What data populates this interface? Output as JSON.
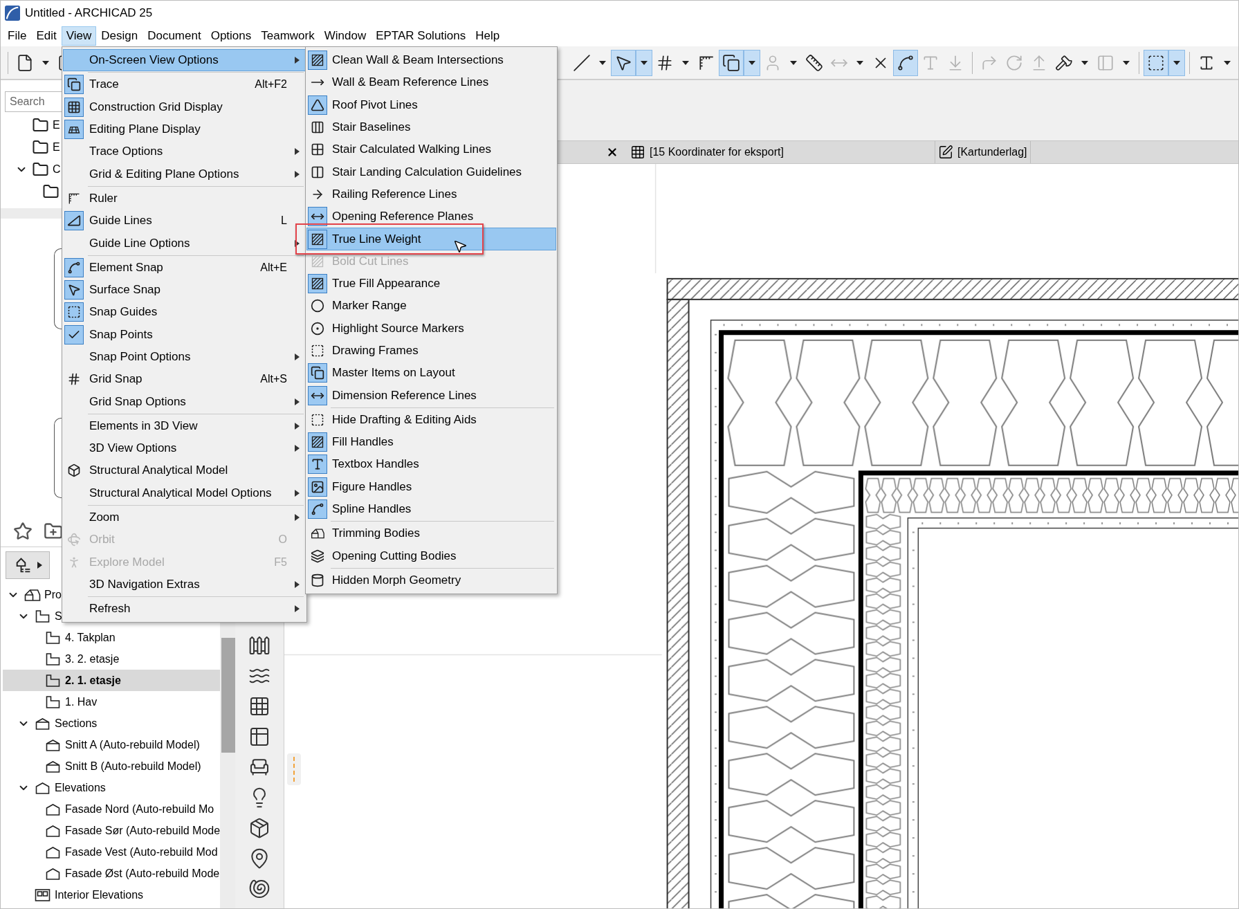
{
  "window": {
    "title": "Untitled - ARCHICAD 25"
  },
  "menu_bar": [
    {
      "label": "File",
      "selected": false
    },
    {
      "label": "Edit",
      "selected": false
    },
    {
      "label": "View",
      "selected": true
    },
    {
      "label": "Design",
      "selected": false
    },
    {
      "label": "Document",
      "selected": false
    },
    {
      "label": "Options",
      "selected": false
    },
    {
      "label": "Teamwork",
      "selected": false
    },
    {
      "label": "Window",
      "selected": false
    },
    {
      "label": "EPTAR Solutions",
      "selected": false
    },
    {
      "label": "Help",
      "selected": false
    }
  ],
  "toolbar": [
    {
      "kind": "separator"
    },
    {
      "kind": "button",
      "selected": false,
      "disabled": false
    },
    {
      "kind": "caret",
      "selected": false
    },
    {
      "kind": "button",
      "selected": false,
      "disabled": false
    },
    {
      "kind": "spacer"
    },
    {
      "kind": "button",
      "selected": false,
      "disabled": false
    },
    {
      "kind": "caret",
      "selected": false
    },
    {
      "kind": "button",
      "selected": true,
      "disabled": false
    },
    {
      "kind": "caret",
      "selected": true
    },
    {
      "kind": "button",
      "selected": false,
      "disabled": false
    },
    {
      "kind": "caret",
      "selected": false
    },
    {
      "kind": "button",
      "selected": false,
      "disabled": false
    },
    {
      "kind": "button",
      "selected": true,
      "disabled": false
    },
    {
      "kind": "caret",
      "selected": true
    },
    {
      "kind": "button",
      "selected": false,
      "disabled": true
    },
    {
      "kind": "caret",
      "selected": false
    },
    {
      "kind": "button",
      "selected": false,
      "disabled": false
    },
    {
      "kind": "button",
      "selected": false,
      "disabled": true
    },
    {
      "kind": "caret",
      "selected": false
    },
    {
      "kind": "button",
      "selected": false,
      "disabled": false
    },
    {
      "kind": "button",
      "selected": true,
      "disabled": false
    },
    {
      "kind": "button",
      "selected": false,
      "disabled": true
    },
    {
      "kind": "button",
      "selected": false,
      "disabled": true
    },
    {
      "kind": "separator"
    },
    {
      "kind": "button",
      "selected": false,
      "disabled": true
    },
    {
      "kind": "button",
      "selected": false,
      "disabled": true
    },
    {
      "kind": "button",
      "selected": false,
      "disabled": true
    },
    {
      "kind": "button",
      "selected": false,
      "disabled": false
    },
    {
      "kind": "caret",
      "selected": false
    },
    {
      "kind": "button",
      "selected": false,
      "disabled": true
    },
    {
      "kind": "caret",
      "selected": false
    },
    {
      "kind": "separator"
    },
    {
      "kind": "button",
      "selected": true,
      "disabled": false
    },
    {
      "kind": "caret",
      "selected": true
    },
    {
      "kind": "separator"
    },
    {
      "kind": "button",
      "selected": false,
      "disabled": false
    },
    {
      "kind": "caret",
      "selected": false
    }
  ],
  "view_menu": [
    {
      "kind": "item",
      "label": "On-Screen View Options",
      "submenu": true,
      "checked": false,
      "disabled": false,
      "selected": true
    },
    {
      "kind": "separator"
    },
    {
      "kind": "item",
      "label": "Trace",
      "shortcut": "Alt+F2",
      "submenu": false,
      "checked": true,
      "disabled": false,
      "selected": false
    },
    {
      "kind": "item",
      "label": "Construction Grid Display",
      "submenu": false,
      "checked": true,
      "disabled": false,
      "selected": false
    },
    {
      "kind": "item",
      "label": "Editing Plane Display",
      "submenu": false,
      "checked": true,
      "disabled": false,
      "selected": false
    },
    {
      "kind": "item",
      "label": "Trace Options",
      "submenu": true,
      "checked": false,
      "disabled": false,
      "selected": false
    },
    {
      "kind": "item",
      "label": "Grid & Editing Plane Options",
      "submenu": true,
      "checked": false,
      "disabled": false,
      "selected": false
    },
    {
      "kind": "separator"
    },
    {
      "kind": "item",
      "label": "Ruler",
      "submenu": false,
      "checked": false,
      "disabled": false,
      "selected": false
    },
    {
      "kind": "item",
      "label": "Guide Lines",
      "shortcut": "L",
      "submenu": false,
      "checked": true,
      "disabled": false,
      "selected": false
    },
    {
      "kind": "item",
      "label": "Guide Line Options",
      "submenu": true,
      "checked": false,
      "disabled": false,
      "selected": false
    },
    {
      "kind": "separator"
    },
    {
      "kind": "item",
      "label": "Element Snap",
      "shortcut": "Alt+E",
      "submenu": false,
      "checked": true,
      "disabled": false,
      "selected": false
    },
    {
      "kind": "item",
      "label": "Surface Snap",
      "submenu": false,
      "checked": true,
      "disabled": false,
      "selected": false
    },
    {
      "kind": "item",
      "label": "Snap Guides",
      "submenu": false,
      "checked": true,
      "disabled": false,
      "selected": false
    },
    {
      "kind": "item",
      "label": "Snap Points",
      "submenu": false,
      "checked": true,
      "disabled": false,
      "selected": false
    },
    {
      "kind": "item",
      "label": "Snap Point Options",
      "submenu": true,
      "checked": false,
      "disabled": false,
      "selected": false
    },
    {
      "kind": "item",
      "label": "Grid Snap",
      "shortcut": "Alt+S",
      "submenu": false,
      "checked": false,
      "disabled": false,
      "selected": false
    },
    {
      "kind": "item",
      "label": "Grid Snap Options",
      "submenu": true,
      "checked": false,
      "disabled": false,
      "selected": false
    },
    {
      "kind": "separator"
    },
    {
      "kind": "item",
      "label": "Elements in 3D View",
      "submenu": true,
      "checked": false,
      "disabled": false,
      "selected": false
    },
    {
      "kind": "item",
      "label": "3D View Options",
      "submenu": true,
      "checked": false,
      "disabled": false,
      "selected": false
    },
    {
      "kind": "item",
      "label": "Structural Analytical Model",
      "submenu": false,
      "checked": false,
      "disabled": false,
      "selected": false
    },
    {
      "kind": "item",
      "label": "Structural Analytical Model Options",
      "submenu": true,
      "checked": false,
      "disabled": false,
      "selected": false
    },
    {
      "kind": "separator"
    },
    {
      "kind": "item",
      "label": "Zoom",
      "submenu": true,
      "checked": false,
      "disabled": false,
      "selected": false
    },
    {
      "kind": "item",
      "label": "Orbit",
      "shortcut": "O",
      "submenu": false,
      "checked": false,
      "disabled": true,
      "selected": false
    },
    {
      "kind": "item",
      "label": "Explore Model",
      "shortcut": "F5",
      "submenu": false,
      "checked": false,
      "disabled": true,
      "selected": false
    },
    {
      "kind": "item",
      "label": "3D Navigation Extras",
      "submenu": true,
      "checked": false,
      "disabled": false,
      "selected": false
    },
    {
      "kind": "separator"
    },
    {
      "kind": "item",
      "label": "Refresh",
      "submenu": true,
      "checked": false,
      "disabled": false,
      "selected": false
    }
  ],
  "submenu": [
    {
      "kind": "item",
      "label": "Clean Wall & Beam Intersections",
      "checked": true,
      "disabled": false,
      "selected": false
    },
    {
      "kind": "item",
      "label": "Wall & Beam Reference Lines",
      "checked": false,
      "disabled": false,
      "selected": false
    },
    {
      "kind": "item",
      "label": "Roof Pivot Lines",
      "checked": true,
      "disabled": false,
      "selected": false
    },
    {
      "kind": "item",
      "label": "Stair Baselines",
      "checked": false,
      "disabled": false,
      "selected": false
    },
    {
      "kind": "item",
      "label": "Stair Calculated Walking Lines",
      "checked": false,
      "disabled": false,
      "selected": false
    },
    {
      "kind": "item",
      "label": "Stair Landing Calculation Guidelines",
      "checked": false,
      "disabled": false,
      "selected": false
    },
    {
      "kind": "item",
      "label": "Railing Reference Lines",
      "checked": false,
      "disabled": false,
      "selected": false
    },
    {
      "kind": "item",
      "label": "Opening Reference Planes",
      "checked": true,
      "disabled": false,
      "selected": false
    },
    {
      "kind": "item",
      "label": "True Line Weight",
      "checked": true,
      "disabled": false,
      "selected": true
    },
    {
      "kind": "item",
      "label": "Bold Cut Lines",
      "checked": false,
      "disabled": true,
      "selected": false
    },
    {
      "kind": "item",
      "label": "True Fill Appearance",
      "checked": true,
      "disabled": false,
      "selected": false
    },
    {
      "kind": "item",
      "label": "Marker Range",
      "checked": false,
      "disabled": false,
      "selected": false
    },
    {
      "kind": "item",
      "label": "Highlight Source Markers",
      "checked": false,
      "disabled": false,
      "selected": false
    },
    {
      "kind": "item",
      "label": "Drawing Frames",
      "checked": false,
      "disabled": false,
      "selected": false
    },
    {
      "kind": "item",
      "label": "Master Items on Layout",
      "checked": true,
      "disabled": false,
      "selected": false
    },
    {
      "kind": "item",
      "label": "Dimension Reference Lines",
      "checked": true,
      "disabled": false,
      "selected": false
    },
    {
      "kind": "separator"
    },
    {
      "kind": "item",
      "label": "Hide Drafting & Editing Aids",
      "checked": false,
      "disabled": false,
      "selected": false
    },
    {
      "kind": "item",
      "label": "Fill Handles",
      "checked": true,
      "disabled": false,
      "selected": false
    },
    {
      "kind": "item",
      "label": "Textbox Handles",
      "checked": true,
      "disabled": false,
      "selected": false
    },
    {
      "kind": "item",
      "label": "Figure Handles",
      "checked": true,
      "disabled": false,
      "selected": false
    },
    {
      "kind": "item",
      "label": "Spline Handles",
      "checked": true,
      "disabled": false,
      "selected": false
    },
    {
      "kind": "separator"
    },
    {
      "kind": "item",
      "label": "Trimming Bodies",
      "checked": false,
      "disabled": false,
      "selected": false
    },
    {
      "kind": "item",
      "label": "Opening Cutting Bodies",
      "checked": false,
      "disabled": false,
      "selected": false
    },
    {
      "kind": "separator"
    },
    {
      "kind": "item",
      "label": "Hidden Morph Geometry",
      "checked": false,
      "disabled": false,
      "selected": false
    }
  ],
  "project_map": {
    "search": {
      "placeholder": "Search"
    },
    "items": [
      {
        "kind": "folder",
        "label": "E",
        "selected": false
      },
      {
        "kind": "folder",
        "label": "E",
        "selected": false
      },
      {
        "kind": "folder",
        "label": "C",
        "selected": false,
        "expanded": true,
        "children": [
          {
            "kind": "folder",
            "selected": false
          }
        ]
      }
    ]
  },
  "navigator": {
    "items": [
      {
        "kind": "project",
        "label": "Pro",
        "selected": false,
        "expanded": true,
        "children": [
          {
            "kind": "story",
            "label": "S",
            "selected": false,
            "expanded": true,
            "children": [
              {
                "kind": "story",
                "label": "4. Takplan",
                "selected": false
              },
              {
                "kind": "story",
                "label": "3. 2. etasje",
                "selected": false
              },
              {
                "kind": "story",
                "label": "2. 1. etasje",
                "selected": true
              },
              {
                "kind": "story",
                "label": "1. Hav",
                "selected": false
              }
            ]
          },
          {
            "kind": "section",
            "label": "Sections",
            "selected": false,
            "expanded": true,
            "children": [
              {
                "kind": "section",
                "label": "Snitt A (Auto-rebuild Model)",
                "selected": false
              },
              {
                "kind": "section",
                "label": "Snitt B (Auto-rebuild Model)",
                "selected": false
              }
            ]
          },
          {
            "kind": "elevation",
            "label": "Elevations",
            "selected": false,
            "expanded": true,
            "children": [
              {
                "kind": "elevation",
                "label": "Fasade Nord (Auto-rebuild Mo",
                "selected": false
              },
              {
                "kind": "elevation",
                "label": "Fasade Sør (Auto-rebuild Mode",
                "selected": false
              },
              {
                "kind": "elevation",
                "label": "Fasade Vest (Auto-rebuild Mod",
                "selected": false
              },
              {
                "kind": "elevation",
                "label": "Fasade Øst (Auto-rebuild Mode",
                "selected": false
              }
            ]
          },
          {
            "kind": "interior",
            "label": "Interior Elevations",
            "selected": false
          }
        ]
      }
    ]
  },
  "tabs": [
    {
      "kind": "worksheet",
      "label": "[15 Koordinater for eksport]",
      "selected": false
    },
    {
      "kind": "drawing",
      "label": "[Kartunderlag]",
      "selected": false
    }
  ]
}
